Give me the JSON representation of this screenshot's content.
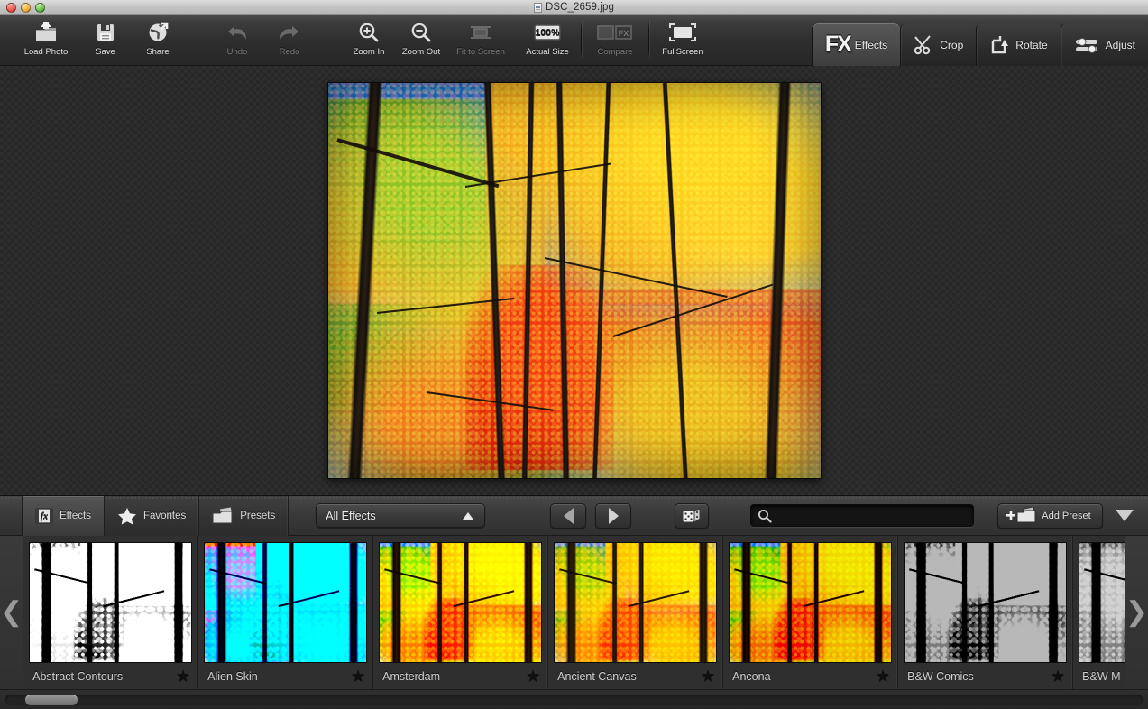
{
  "window": {
    "title": "DSC_2659.jpg",
    "doc_icon": "document-icon",
    "close_label": "close",
    "minimize_label": "minimize",
    "zoom_label": "zoom"
  },
  "toolbar": {
    "buttons": [
      {
        "label": "Load Photo",
        "icon": "folder-upload-icon",
        "disabled": false
      },
      {
        "label": "Save",
        "icon": "floppy-disk-icon",
        "disabled": false
      },
      {
        "label": "Share",
        "icon": "globe-share-icon",
        "disabled": false
      },
      {
        "label": "Undo",
        "icon": "undo-arrow-icon",
        "disabled": true
      },
      {
        "label": "Redo",
        "icon": "redo-arrow-icon",
        "disabled": true
      },
      {
        "label": "Zoom In",
        "icon": "magnifier-plus-icon",
        "disabled": false
      },
      {
        "label": "Zoom Out",
        "icon": "magnifier-minus-icon",
        "disabled": false
      },
      {
        "label": "Fit to Screen",
        "icon": "fit-screen-icon",
        "disabled": true
      },
      {
        "label": "Actual Size",
        "icon": "hundred-percent-icon",
        "disabled": false
      },
      {
        "label": "Compare",
        "icon": "compare-fx-icon",
        "disabled": true
      },
      {
        "label": "FullScreen",
        "icon": "fullscreen-icon",
        "disabled": false
      }
    ],
    "tabs": [
      {
        "label": "Effects",
        "icon": "fx-icon",
        "active": true
      },
      {
        "label": "Crop",
        "icon": "scissors-icon",
        "active": false
      },
      {
        "label": "Rotate",
        "icon": "rotate-icon",
        "active": false
      },
      {
        "label": "Adjust",
        "icon": "sliders-icon",
        "active": false
      }
    ]
  },
  "canvas": {
    "photo_alt": "autumn-forest-photo"
  },
  "browser": {
    "segments": [
      {
        "label": "Effects",
        "icon": "fx-film-icon",
        "active": true
      },
      {
        "label": "Favorites",
        "icon": "star-icon",
        "active": false
      },
      {
        "label": "Presets",
        "icon": "preset-cards-icon",
        "active": false
      }
    ],
    "category": {
      "value": "All Effects",
      "caret": "caret-up-icon"
    },
    "prev_label": "previous",
    "next_label": "next",
    "random_label": "random-effect",
    "search": {
      "value": "",
      "placeholder": ""
    },
    "add_preset": {
      "label": "Add Preset",
      "icon": "plus-folder-icon"
    },
    "collapse_label": "collapse-panel",
    "scroll_left_label": "scroll-left",
    "scroll_right_label": "scroll-right",
    "effects": [
      {
        "name": "Abstract Contours",
        "style": "f-abstract",
        "favorite": true
      },
      {
        "name": "Alien Skin",
        "style": "f-alien",
        "favorite": true
      },
      {
        "name": "Amsterdam",
        "style": "f-amsterdam",
        "favorite": true
      },
      {
        "name": "Ancient Canvas",
        "style": "f-ancient",
        "favorite": true
      },
      {
        "name": "Ancona",
        "style": "f-ancona",
        "favorite": true
      },
      {
        "name": "B&W Comics",
        "style": "f-bwcomics",
        "favorite": true
      },
      {
        "name": "B&W M",
        "style": "f-bwm",
        "favorite": false
      }
    ]
  },
  "colors": {
    "toolbar_bg": "#2e2e2e",
    "panel_bg": "#303030",
    "canvas_bg": "#2e2e2e",
    "text": "#e2e2e2",
    "disabled_text": "#7a7a7a",
    "accent_sky": "#2a79c4"
  }
}
